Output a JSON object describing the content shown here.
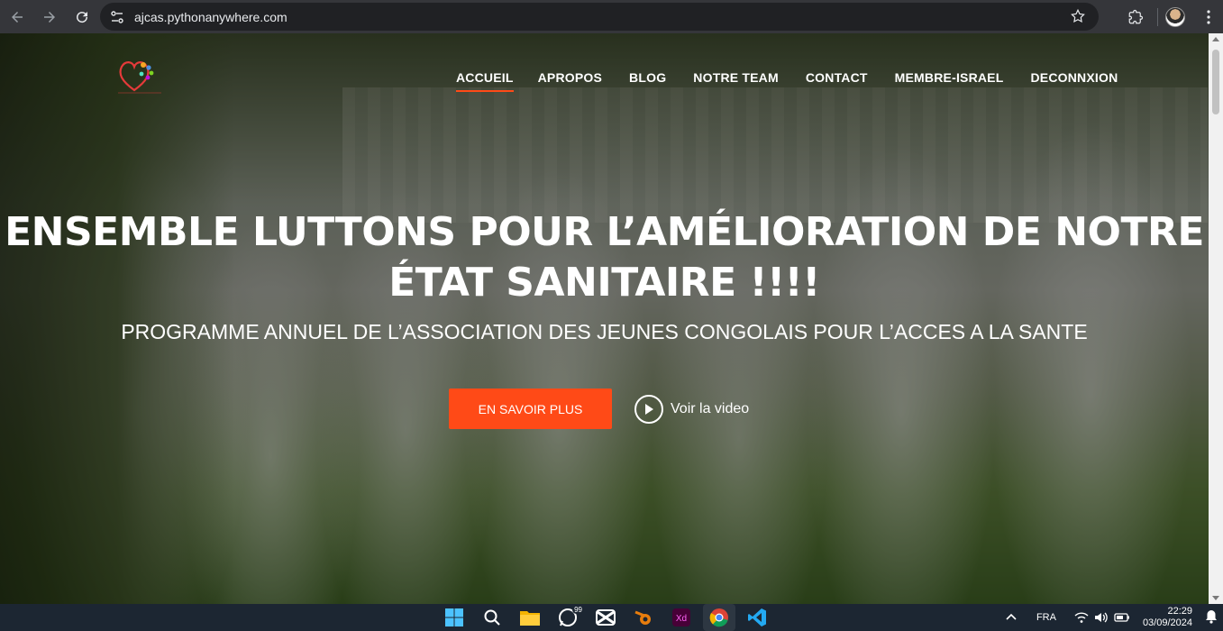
{
  "browser": {
    "url": "ajcas.pythonanywhere.com",
    "icons": [
      "back-icon",
      "forward-icon",
      "reload-icon",
      "site-info-icon",
      "star-icon",
      "extensions-icon",
      "profile-avatar",
      "menu-icon"
    ]
  },
  "nav": {
    "items": [
      {
        "label": "ACCUEIL",
        "active": true
      },
      {
        "label": "APROPOS"
      },
      {
        "label": "BLOG"
      },
      {
        "label": "NOTRE TEAM"
      },
      {
        "label": "CONTACT"
      },
      {
        "label": "MEMBRE-ISRAEL"
      },
      {
        "label": "DECONNXION"
      }
    ]
  },
  "hero": {
    "title_line1": "ENSEMBLE LUTTONS POUR L’AMÉLIORATION DE NOTRE",
    "title_line2": "ÉTAT SANITAIRE !!!!",
    "subtitle": "PROGRAMME ANNUEL DE L’ASSOCIATION DES JEUNES CONGOLAIS POUR L’ACCES A LA SANTE",
    "cta_label": "EN SAVOIR PLUS",
    "video_label": "Voir la video"
  },
  "colors": {
    "accent": "#ff4a17",
    "chrome": "#35363a",
    "taskbar": "#1c2632"
  },
  "taskbar": {
    "apps": [
      "windows-start-icon",
      "search-icon",
      "file-explorer-icon",
      "whatsapp-icon",
      "capcut-icon",
      "blender-icon",
      "adobe-xd-icon",
      "chrome-icon",
      "vscode-icon"
    ],
    "whatsapp_badge": "99",
    "lang": "FRA",
    "time": "22:29",
    "date": "03/09/2024"
  }
}
